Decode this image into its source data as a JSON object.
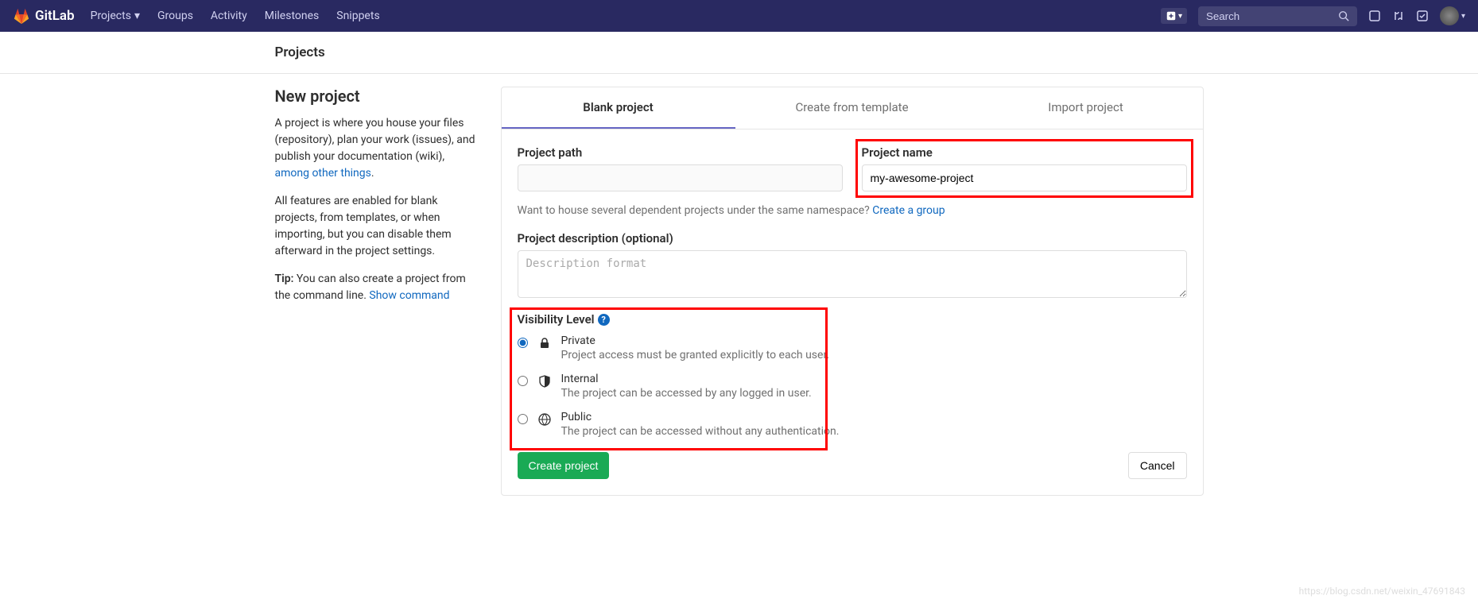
{
  "navbar": {
    "brand": "GitLab",
    "links": [
      "Projects",
      "Groups",
      "Activity",
      "Milestones",
      "Snippets"
    ],
    "search_placeholder": "Search"
  },
  "sub_header": "Projects",
  "sidebar": {
    "heading": "New project",
    "p1a": "A project is where you house your files (repository), plan your work (issues), and publish your documentation (wiki), ",
    "p1_link": "among other things",
    "p1b": ".",
    "p2": "All features are enabled for blank projects, from templates, or when importing, but you can disable them afterward in the project settings.",
    "p3_tip": "Tip:",
    "p3_text": " You can also create a project from the command line. ",
    "p3_link": "Show command"
  },
  "tabs": [
    "Blank project",
    "Create from template",
    "Import project"
  ],
  "form": {
    "path_label": "Project path",
    "path_value": "",
    "name_label": "Project name",
    "name_value": "my-awesome-project",
    "namespace_help": "Want to house several dependent projects under the same namespace? ",
    "namespace_link": "Create a group",
    "desc_label": "Project description (optional)",
    "desc_placeholder": "Description format",
    "visibility_label": "Visibility Level",
    "visibility": [
      {
        "name": "Private",
        "desc": "Project access must be granted explicitly to each user.",
        "checked": true
      },
      {
        "name": "Internal",
        "desc": "The project can be accessed by any logged in user.",
        "checked": false
      },
      {
        "name": "Public",
        "desc": "The project can be accessed without any authentication.",
        "checked": false
      }
    ],
    "submit": "Create project",
    "cancel": "Cancel"
  },
  "watermark": "https://blog.csdn.net/weixin_47691843"
}
